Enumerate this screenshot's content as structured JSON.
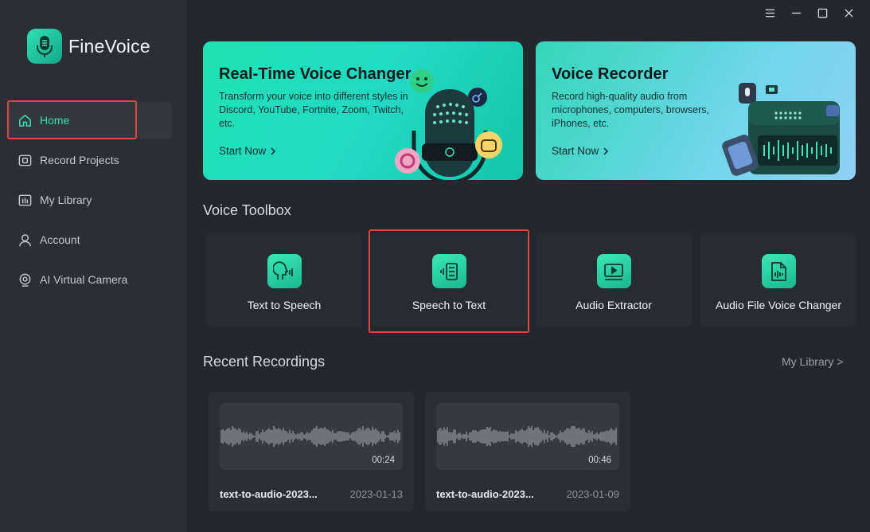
{
  "app": {
    "name": "FineVoice"
  },
  "sidebar": {
    "items": [
      {
        "label": "Home",
        "icon": "home-icon",
        "active": true
      },
      {
        "label": "Record Projects",
        "icon": "record-projects-icon"
      },
      {
        "label": "My Library",
        "icon": "library-icon"
      },
      {
        "label": "Account",
        "icon": "account-icon"
      },
      {
        "label": "AI Virtual Camera",
        "icon": "camera-icon"
      }
    ]
  },
  "window_controls": [
    "menu-icon",
    "minimize-icon",
    "maximize-icon",
    "close-icon"
  ],
  "banners": [
    {
      "title": "Real-Time Voice Changer",
      "description": "Transform your voice into different styles in Discord, YouTube, Fortnite, Zoom, Twitch, etc.",
      "cta": "Start Now"
    },
    {
      "title": "Voice Recorder",
      "description": "Record high-quality audio from microphones, computers, browsers, iPhones, etc.",
      "cta": "Start Now"
    }
  ],
  "toolbox": {
    "title": "Voice Toolbox",
    "tools": [
      {
        "label": "Text to Speech",
        "icon": "text-to-speech-icon"
      },
      {
        "label": "Speech to Text",
        "icon": "speech-to-text-icon"
      },
      {
        "label": "Audio Extractor",
        "icon": "audio-extractor-icon"
      },
      {
        "label": "Audio File Voice Changer",
        "icon": "audio-file-icon"
      }
    ]
  },
  "recent": {
    "title": "Recent Recordings",
    "link": "My Library >",
    "items": [
      {
        "name": "text-to-audio-2023...",
        "date": "2023-01-13",
        "duration": "00:24"
      },
      {
        "name": "text-to-audio-2023...",
        "date": "2023-01-09",
        "duration": "00:46"
      }
    ]
  },
  "colors": {
    "accent": "#3ee0b6",
    "highlight": "#e2453f",
    "background": "#23272e",
    "sidebar": "#2a2f37"
  }
}
